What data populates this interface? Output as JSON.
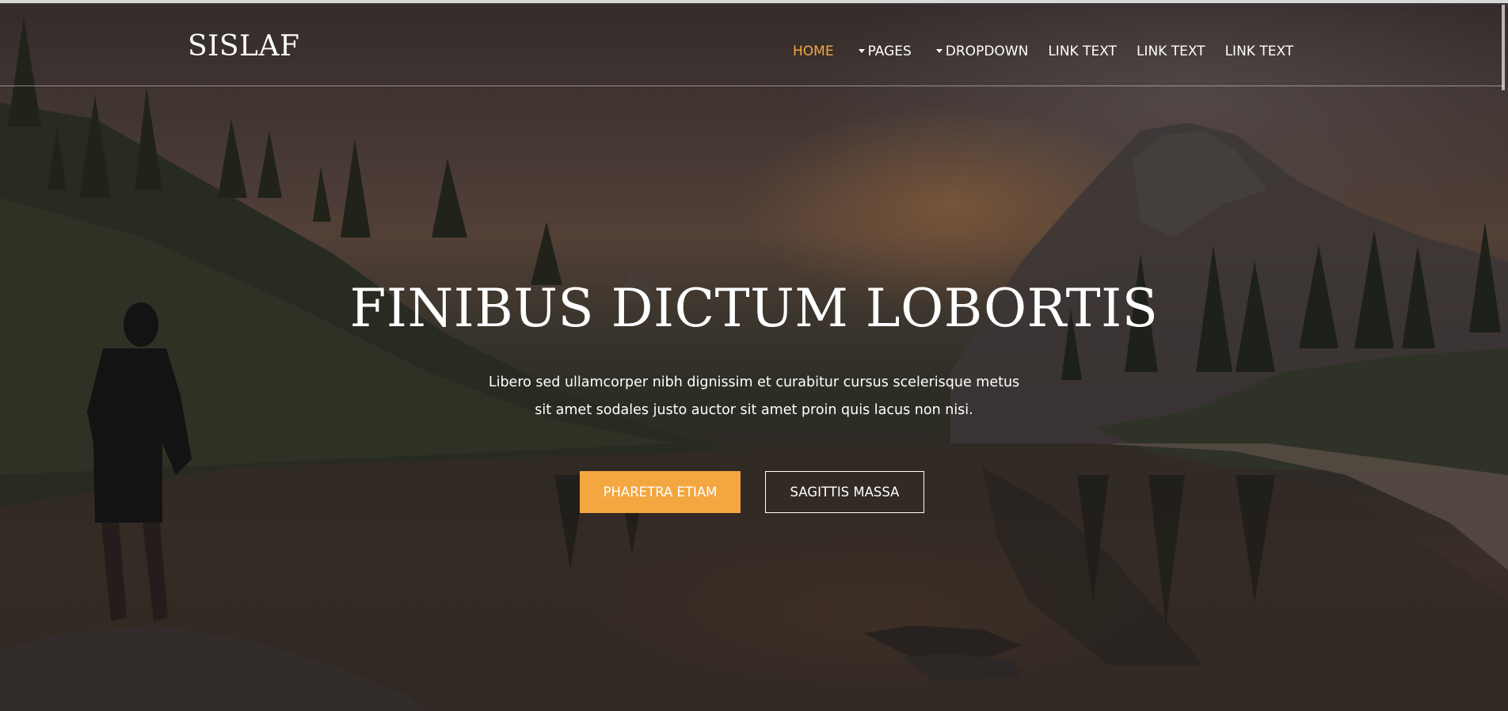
{
  "brand": {
    "logo_text": "SISLAF"
  },
  "nav": {
    "items": [
      {
        "label": "HOME",
        "active": true,
        "dropdown": false
      },
      {
        "label": "PAGES",
        "active": false,
        "dropdown": true
      },
      {
        "label": "DROPDOWN",
        "active": false,
        "dropdown": true
      },
      {
        "label": "LINK TEXT",
        "active": false,
        "dropdown": false
      },
      {
        "label": "LINK TEXT",
        "active": false,
        "dropdown": false
      },
      {
        "label": "LINK TEXT",
        "active": false,
        "dropdown": false
      }
    ]
  },
  "hero": {
    "title": "FINIBUS DICTUM LOBORTIS",
    "subtitle_line1": "Libero sed ullamcorper nibh dignissim et curabitur cursus scelerisque metus",
    "subtitle_line2": "sit amet sodales justo auctor sit amet proin quis lacus non nisi.",
    "primary_button": "PHARETRA ETIAM",
    "secondary_button": "SAGITTIS MASSA"
  },
  "colors": {
    "accent": "#f4a640",
    "text": "#ffffff"
  }
}
